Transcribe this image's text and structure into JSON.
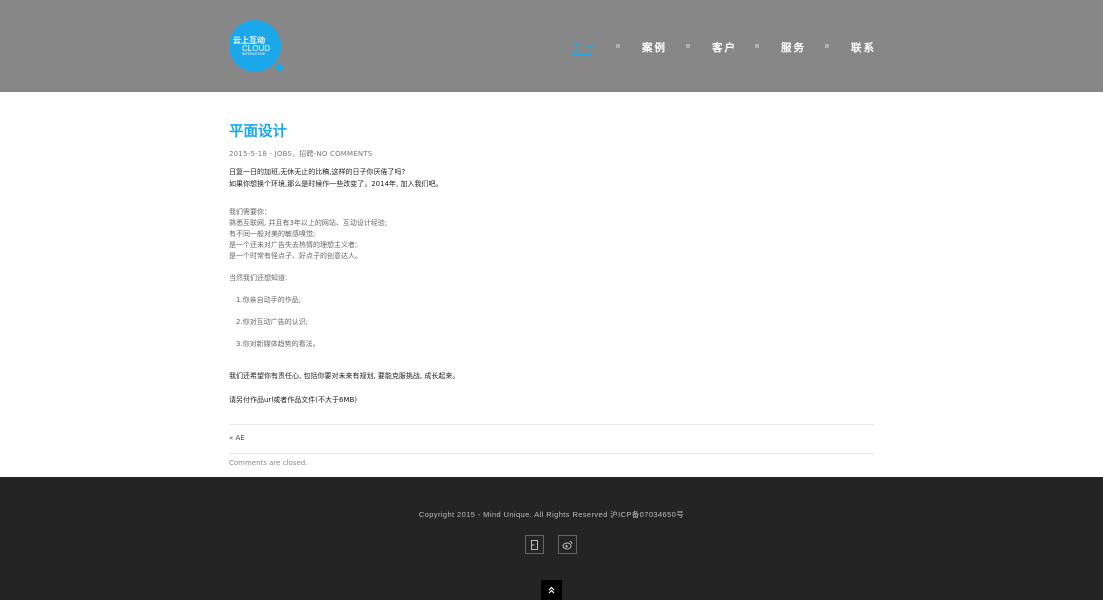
{
  "logo": {
    "cn": "云上互动",
    "en": "CLOUD",
    "sub": "INTERACTIVE"
  },
  "nav": [
    {
      "label": "关于",
      "active": true
    },
    {
      "label": "案例",
      "active": false
    },
    {
      "label": "客户",
      "active": false
    },
    {
      "label": "服务",
      "active": false
    },
    {
      "label": "联系",
      "active": false
    }
  ],
  "post": {
    "title": "平面设计",
    "meta": "2015-5-18 - JOBS，招聘-NO COMMENTS",
    "intro": [
      "日复一日的加班,无休无止的比稿,这样的日子你厌倦了吗?",
      "如果你想换个环境,那么是时候作一些改变了，2014年, 加入我们吧。"
    ],
    "needs": [
      "我们需要你：",
      "熟悉互联网, 并且有3年以上的网站、互动设计经验;",
      "有不同一般对美的敏感嗅觉;",
      "是一个还未对广告失去热情的理想主义者;",
      "是一个时常有怪点子、好点子的创意达人。"
    ],
    "know": "当然我们还想知道:",
    "list": [
      "1.你亲自动手的作品;",
      "2.你对互动广告的认识;",
      "3.你对新媒体趋势的看法。"
    ],
    "hope": "我们还希望你有责任心, 包括你要对未来有规划, 要能克服挑战, 成长起来。",
    "attach": "请另付作品url或者作品文件(不大于6MB)"
  },
  "prev_link": "« AE",
  "comments_closed": "Comments are closed.",
  "footer": {
    "copyright": "Copyright 2015 - Mind Unique. All Rights Reserved 沪ICP备07034650号",
    "icons": [
      "door-icon",
      "weibo-icon"
    ],
    "totop_icon": "double-chevron-up-icon"
  },
  "colors": {
    "accent": "#1ba8ea",
    "header": "#878787",
    "footer": "#242424"
  }
}
